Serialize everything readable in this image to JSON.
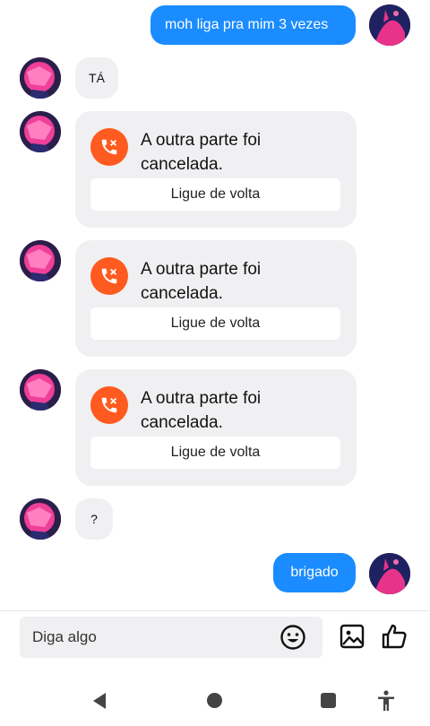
{
  "messages": {
    "out_1": "moh liga pra mim 3 vezes",
    "in_1": "TÁ",
    "in_2": "?",
    "out_2": "brigado"
  },
  "calls": [
    {
      "text": "A outra parte foi cancelada.",
      "button": "Ligue de volta"
    },
    {
      "text": "A outra parte foi cancelada.",
      "button": "Ligue de volta"
    },
    {
      "text": "A outra parte foi cancelada.",
      "button": "Ligue de volta"
    }
  ],
  "composer": {
    "placeholder": "Diga algo"
  },
  "icons": {
    "emoji": "emoji-icon",
    "image": "image-icon",
    "like": "thumbs-up-icon",
    "missed_call": "missed-call-icon"
  },
  "colors": {
    "outgoing_bubble": "#1a8cff",
    "incoming_bubble": "#f0f0f2",
    "missed_call": "#ff5a1f"
  }
}
